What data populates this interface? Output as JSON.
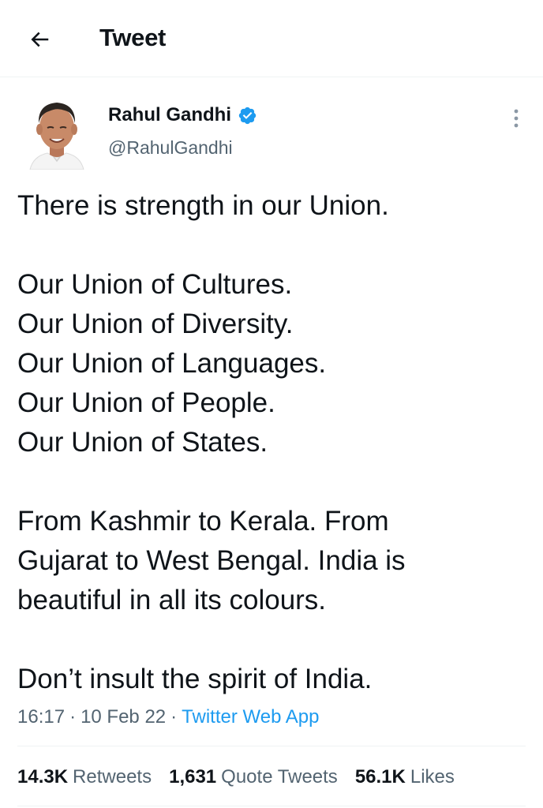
{
  "header": {
    "back_icon": "arrow-left-icon",
    "title": "Tweet"
  },
  "author": {
    "name": "Rahul Gandhi",
    "handle": "@RahulGandhi",
    "verified_icon": "verified-badge-icon",
    "avatar_icon": "avatar-photo",
    "more_icon": "more-vertical-icon"
  },
  "tweet": {
    "lines": [
      "There is strength in our Union.",
      "",
      "Our Union of Cultures.",
      "Our Union of Diversity.",
      "Our Union of Languages.",
      "Our Union of People.",
      "Our Union of States.",
      "",
      "From Kashmir to Kerala. From",
      "Gujarat to West Bengal. India is",
      "beautiful in all its colours.",
      "",
      "Don’t insult the spirit of India."
    ]
  },
  "meta": {
    "time": "16:17",
    "date": "10 Feb 22",
    "source": "Twitter Web App",
    "separator": "·"
  },
  "stats": {
    "retweets_count": "14.3K",
    "retweets_label": "Retweets",
    "quotes_count": "1,631",
    "quotes_label": "Quote Tweets",
    "likes_count": "56.1K",
    "likes_label": "Likes"
  },
  "colors": {
    "accent": "#1d9bf0",
    "text": "#0f1419",
    "secondary": "#536471",
    "divider": "#eff3f4"
  }
}
